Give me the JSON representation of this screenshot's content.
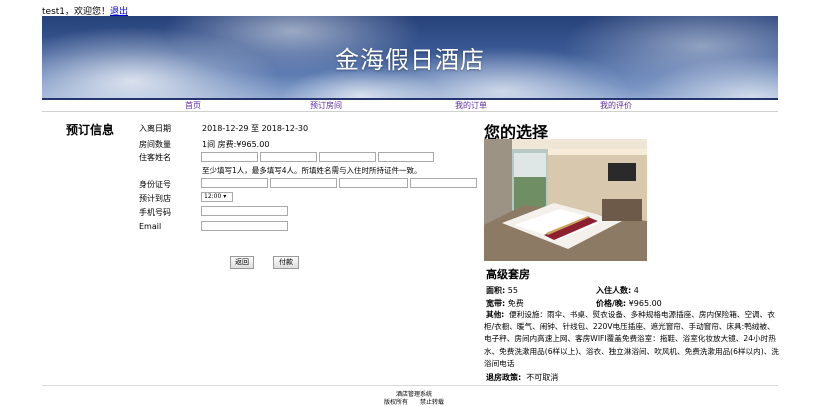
{
  "topbar": {
    "greeting": "test1，欢迎您！",
    "logout": "退出"
  },
  "banner": {
    "title": "金海假日酒店"
  },
  "nav": {
    "items": [
      "首页",
      "预订房间",
      "我的订单",
      "我的评价"
    ]
  },
  "booking": {
    "heading": "预订信息",
    "checkin_label": "入离日期",
    "checkin_value": "2018-12-29 至 2018-12-30",
    "rooms_label": "房间数量",
    "rooms_value": "1间  房费:¥965.00",
    "guest_label": "住客姓名",
    "guest_hint": "至少填写1人，最多填写4人。所填姓名需与入住时所持证件一致。",
    "id_label": "身份证号",
    "arrival_label": "预计到店",
    "arrival_value": "12:00",
    "phone_label": "手机号码",
    "email_label": "Email",
    "back_button": "返回",
    "pay_button": "付款"
  },
  "choice": {
    "heading": "您的选择",
    "room_name": "高级套房",
    "area_label": "面积:",
    "area_value": "55",
    "guests_label": "入住人数:",
    "guests_value": "4",
    "broadband_label": "宽带:",
    "broadband_value": "免费",
    "price_label": "价格/晚:",
    "price_value": "¥965.00",
    "other_label": "其他:",
    "other_value": "便利设施：雨伞、书桌、熨衣设备、多种规格电源插座、房内保险箱、空调、衣柜/衣橱、暖气、闹钟、针线包、220V电压插座、遮光窗帘、手动窗帘、床具:鸭绒被、电子秤、房间内高速上网、客房WIFI覆盖免费浴室：拖鞋、浴室化妆放大镜、24小时热水、免费洗漱用品(6样以上)、浴衣、独立淋浴间、吹风机、免费洗漱用品(6样以内)、洗浴间电话",
    "policy_label": "退房政策:",
    "policy_value": "不可取消"
  },
  "footer": {
    "line1": "酒店管理系统",
    "line2a": "版权所有",
    "line2b": "禁止转载"
  }
}
